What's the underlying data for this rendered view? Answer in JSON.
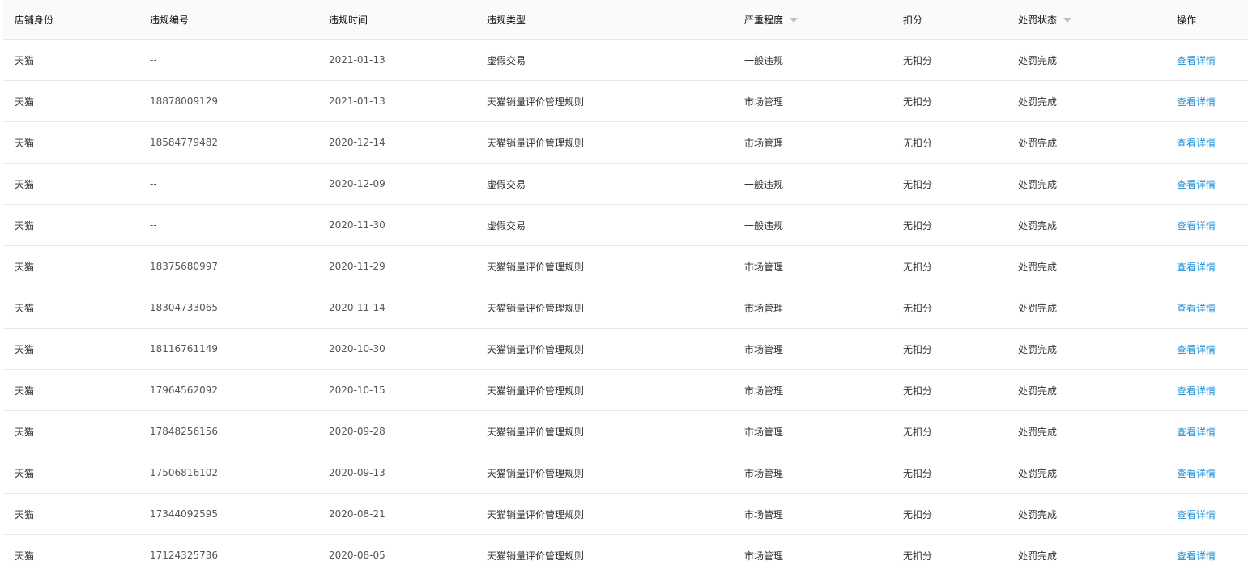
{
  "columns": [
    "店铺身份",
    "违规编号",
    "违规时间",
    "违规类型",
    "严重程度",
    "扣分",
    "处罚状态",
    "操作"
  ],
  "rows": [
    {
      "shop": "天猫",
      "id": "--",
      "date": "2021-01-13",
      "type": "虚假交易",
      "severity": "一般违规",
      "points": "无扣分",
      "status": "处罚完成",
      "action": "查看详情"
    },
    {
      "shop": "天猫",
      "id": "18878009129",
      "date": "2021-01-13",
      "type": "天猫销量评价管理规则",
      "severity": "市场管理",
      "points": "无扣分",
      "status": "处罚完成",
      "action": "查看详情"
    },
    {
      "shop": "天猫",
      "id": "18584779482",
      "date": "2020-12-14",
      "type": "天猫销量评价管理规则",
      "severity": "市场管理",
      "points": "无扣分",
      "status": "处罚完成",
      "action": "查看详情"
    },
    {
      "shop": "天猫",
      "id": "--",
      "date": "2020-12-09",
      "type": "虚假交易",
      "severity": "一般违规",
      "points": "无扣分",
      "status": "处罚完成",
      "action": "查看详情"
    },
    {
      "shop": "天猫",
      "id": "--",
      "date": "2020-11-30",
      "type": "虚假交易",
      "severity": "一般违规",
      "points": "无扣分",
      "status": "处罚完成",
      "action": "查看详情"
    },
    {
      "shop": "天猫",
      "id": "18375680997",
      "date": "2020-11-29",
      "type": "天猫销量评价管理规则",
      "severity": "市场管理",
      "points": "无扣分",
      "status": "处罚完成",
      "action": "查看详情"
    },
    {
      "shop": "天猫",
      "id": "18304733065",
      "date": "2020-11-14",
      "type": "天猫销量评价管理规则",
      "severity": "市场管理",
      "points": "无扣分",
      "status": "处罚完成",
      "action": "查看详情"
    },
    {
      "shop": "天猫",
      "id": "18116761149",
      "date": "2020-10-30",
      "type": "天猫销量评价管理规则",
      "severity": "市场管理",
      "points": "无扣分",
      "status": "处罚完成",
      "action": "查看详情"
    },
    {
      "shop": "天猫",
      "id": "17964562092",
      "date": "2020-10-15",
      "type": "天猫销量评价管理规则",
      "severity": "市场管理",
      "points": "无扣分",
      "status": "处罚完成",
      "action": "查看详情"
    },
    {
      "shop": "天猫",
      "id": "17848256156",
      "date": "2020-09-28",
      "type": "天猫销量评价管理规则",
      "severity": "市场管理",
      "points": "无扣分",
      "status": "处罚完成",
      "action": "查看详情"
    },
    {
      "shop": "天猫",
      "id": "17506816102",
      "date": "2020-09-13",
      "type": "天猫销量评价管理规则",
      "severity": "市场管理",
      "points": "无扣分",
      "status": "处罚完成",
      "action": "查看详情"
    },
    {
      "shop": "天猫",
      "id": "17344092595",
      "date": "2020-08-21",
      "type": "天猫销量评价管理规则",
      "severity": "市场管理",
      "points": "无扣分",
      "status": "处罚完成",
      "action": "查看详情"
    },
    {
      "shop": "天猫",
      "id": "17124325736",
      "date": "2020-08-05",
      "type": "天猫销量评价管理规则",
      "severity": "市场管理",
      "points": "无扣分",
      "status": "处罚完成",
      "action": "查看详情"
    }
  ],
  "colors": {
    "link": "#1a8fd6",
    "header_bg": "#fafafa",
    "border": "#e8e8e8",
    "filter_icon": "#bfbfbf"
  }
}
